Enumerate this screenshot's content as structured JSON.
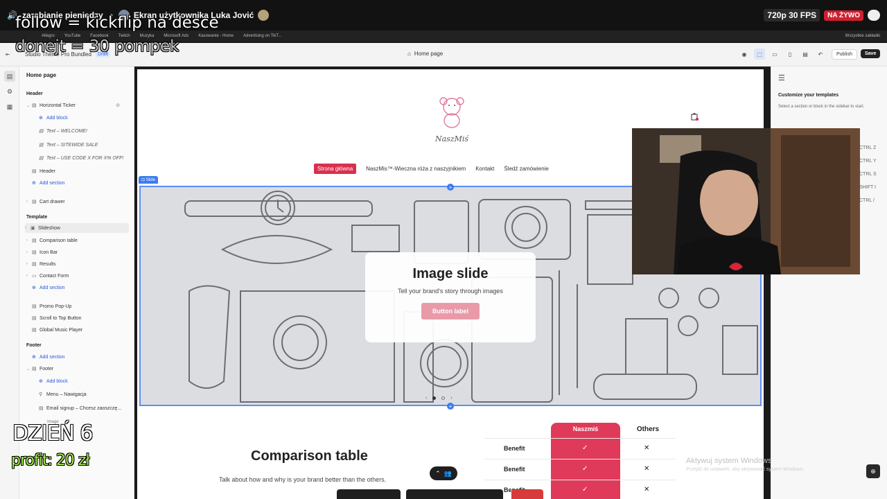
{
  "stream": {
    "title": "zarabianie pieniędzy",
    "separator": "•",
    "subtitle": "Ekran użytkownika Luka Jović",
    "quality": "720p 30 FPS",
    "live": "NA ŻYWO"
  },
  "overlays": {
    "line1": "follow = kickflip na desce",
    "line2": "donejt = 30 pompek",
    "day": "DZIEŃ 6",
    "profit": "profit: 20 zł"
  },
  "bookmarks": {
    "items": [
      "Allegro",
      "YouTube",
      "Facebook",
      "Twitch",
      "Muzyka",
      "Microsoft Ads",
      "Kasowanie - Home",
      "Advertising on TikT..."
    ],
    "other": "Wszystkie zakładki"
  },
  "app_bar": {
    "theme_name": "Studio Theme Pro Bundled",
    "draft": "Draft",
    "more": "...",
    "page": "Home page",
    "publish": "Publish",
    "save": "Save"
  },
  "sidebar": {
    "page_title": "Home page",
    "header_label": "Header",
    "horizontal_ticker": "Horizontal Ticker",
    "add_block": "Add block",
    "ticker_texts": [
      "Text – WELCOME!",
      "Text – SITEWIDE SALE",
      "Text – USE CODE X FOR X% OFF!"
    ],
    "header": "Header",
    "add_section": "Add section",
    "cart_drawer": "Cart drawer",
    "template_label": "Template",
    "template_items": [
      "Slideshow",
      "Comparison table",
      "Icon Bar",
      "Results",
      "Contact Form"
    ],
    "extras": [
      "Promo Pop-Up",
      "Scroll to Top Button",
      "Global Music Player"
    ],
    "footer_label": "Footer",
    "footer": "Footer",
    "footer_blocks": [
      "Menu – Nawigacja",
      "Email signup – Chcesz zaoszczę..."
    ],
    "image_label": "Image"
  },
  "store": {
    "logo_text": "NaszMiś",
    "nav": [
      "Strona główna",
      "NaszMis™-Wieczna róża z naszyjnikiem",
      "Kontakt",
      "Śledź zamówienie"
    ],
    "slide_tag": "Slide",
    "slide_heading": "Image slide",
    "slide_text": "Tell your brand's story through images",
    "slide_button": "Button label",
    "slide_prev": "‹",
    "slide_next": "›"
  },
  "comparison": {
    "title": "Comparison table",
    "subtitle": "Talk about how and why is your brand better than the others.",
    "col_brand": "Naszmiś",
    "col_others": "Others",
    "rows": [
      "Benefit",
      "Benefit",
      "Benefit"
    ],
    "check": "✓",
    "cross": "✕"
  },
  "right_panel": {
    "title": "Customize your templates",
    "text": "Select a section or block in the sidebar to start.",
    "shortcuts": [
      "CTRL Z",
      "CTRL Y",
      "CTRL S",
      "SHIFT I",
      "CTRL /"
    ]
  },
  "windows": {
    "activate": "Aktywuj system Windows",
    "activate_sub": "Przejdź do ustawień, aby aktywować system Windows."
  },
  "colors": {
    "brand_pink": "#d9304e",
    "selection_blue": "#3d7bf0",
    "overlay_green": "#9ee84a"
  }
}
